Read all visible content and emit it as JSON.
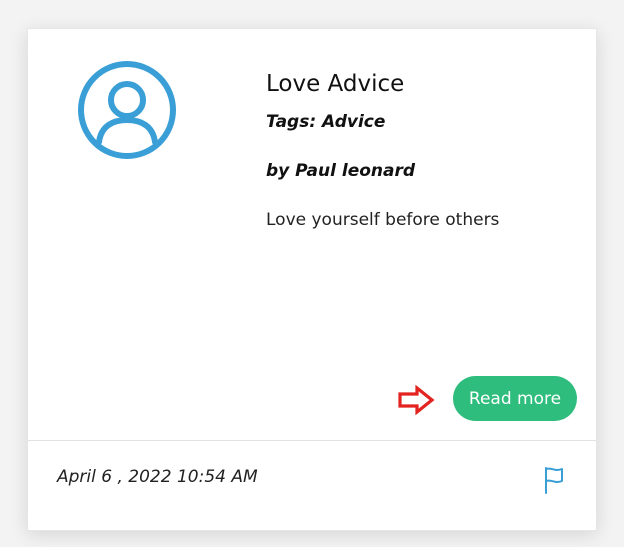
{
  "post": {
    "title": "Love Advice",
    "tags": "Tags: Advice",
    "author": "by Paul leonard",
    "excerpt": "Love yourself before others",
    "read_more_label": "Read more",
    "date": "April 6 , 2022 10:54 AM"
  },
  "icons": {
    "avatar": "user-avatar-icon",
    "arrow": "right-arrow-icon",
    "flag": "flag-icon"
  },
  "colors": {
    "avatar": "#3a9fd6",
    "button": "#2fbd7e",
    "arrow": "#e3231f",
    "flag": "#3a9fd6"
  }
}
